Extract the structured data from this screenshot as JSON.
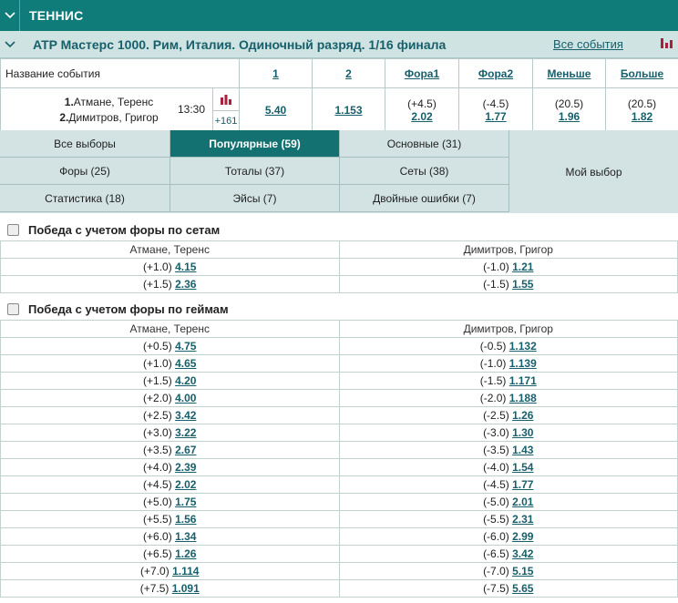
{
  "sport": {
    "title": "ТЕННИС"
  },
  "event_header": {
    "title": "ATP Мастерс 1000. Рим, Италия. Одиночный разряд. 1/16 финала",
    "all_events_label": "Все события",
    "accent": "#a8203a"
  },
  "odds_table": {
    "headers": {
      "name": "Название события",
      "c1": "1",
      "c2": "2",
      "fora1": "Фора1",
      "fora2": "Фора2",
      "less": "Меньше",
      "more": "Больше"
    },
    "event": {
      "player1_num": "1.",
      "player1": "Атмане, Теренс",
      "player2_num": "2.",
      "player2": "Димитров, Григор",
      "time": "13:30",
      "more_count": "+161",
      "odd1": "5.40",
      "odd2": "1.153",
      "fora1_param": "(+4.5)",
      "fora1_odd": "2.02",
      "fora2_param": "(-4.5)",
      "fora2_odd": "1.77",
      "less_param": "(20.5)",
      "less_odd": "1.96",
      "more_param": "(20.5)",
      "more_odd": "1.82"
    }
  },
  "tabs": {
    "all": "Все выборы",
    "popular": "Популярные (59)",
    "main": "Основные (31)",
    "fora": "Форы (25)",
    "totals": "Тоталы (37)",
    "sets": "Сеты (38)",
    "stats": "Статистика (18)",
    "aces": "Эйсы (7)",
    "double_faults": "Двойные ошибки (7)",
    "my_choice": "Мой выбор"
  },
  "market_sets": {
    "title": "Победа с учетом форы по сетам",
    "col1": "Атмане, Теренс",
    "col2": "Димитров, Григор",
    "rows": [
      [
        "(+1.0)",
        "4.15",
        "(-1.0)",
        "1.21"
      ],
      [
        "(+1.5)",
        "2.36",
        "(-1.5)",
        "1.55"
      ]
    ]
  },
  "market_games": {
    "title": "Победа с учетом форы по геймам",
    "col1": "Атмане, Теренс",
    "col2": "Димитров, Григор",
    "rows": [
      [
        "(+0.5)",
        "4.75",
        "(-0.5)",
        "1.132"
      ],
      [
        "(+1.0)",
        "4.65",
        "(-1.0)",
        "1.139"
      ],
      [
        "(+1.5)",
        "4.20",
        "(-1.5)",
        "1.171"
      ],
      [
        "(+2.0)",
        "4.00",
        "(-2.0)",
        "1.188"
      ],
      [
        "(+2.5)",
        "3.42",
        "(-2.5)",
        "1.26"
      ],
      [
        "(+3.0)",
        "3.22",
        "(-3.0)",
        "1.30"
      ],
      [
        "(+3.5)",
        "2.67",
        "(-3.5)",
        "1.43"
      ],
      [
        "(+4.0)",
        "2.39",
        "(-4.0)",
        "1.54"
      ],
      [
        "(+4.5)",
        "2.02",
        "(-4.5)",
        "1.77"
      ],
      [
        "(+5.0)",
        "1.75",
        "(-5.0)",
        "2.01"
      ],
      [
        "(+5.5)",
        "1.56",
        "(-5.5)",
        "2.31"
      ],
      [
        "(+6.0)",
        "1.34",
        "(-6.0)",
        "2.99"
      ],
      [
        "(+6.5)",
        "1.26",
        "(-6.5)",
        "3.42"
      ],
      [
        "(+7.0)",
        "1.114",
        "(-7.0)",
        "5.15"
      ],
      [
        "(+7.5)",
        "1.091",
        "(-7.5)",
        "5.65"
      ]
    ]
  }
}
